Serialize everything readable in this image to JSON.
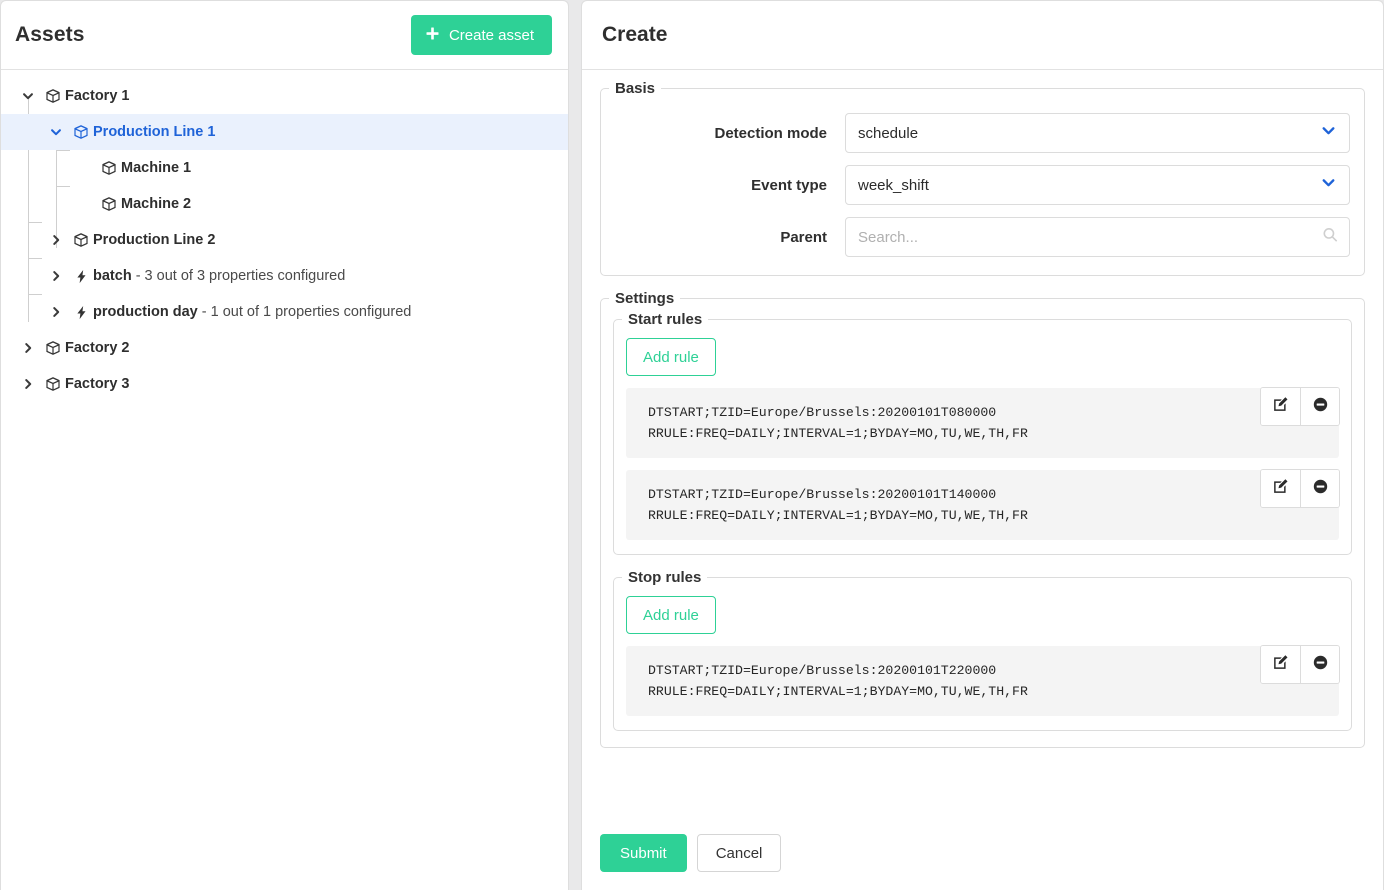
{
  "assets_panel": {
    "title": "Assets",
    "create_button": "Create asset",
    "create_icon": "plus-icon",
    "tree": [
      {
        "label": "Factory 1",
        "icon": "cube-icon",
        "depth": 0,
        "expanded": true,
        "selected": false,
        "has_children": true,
        "suffix": ""
      },
      {
        "label": "Production Line 1",
        "icon": "cube-icon",
        "depth": 1,
        "expanded": true,
        "selected": true,
        "has_children": true,
        "suffix": ""
      },
      {
        "label": "Machine 1",
        "icon": "cube-icon",
        "depth": 2,
        "expanded": false,
        "selected": false,
        "has_children": false,
        "suffix": ""
      },
      {
        "label": "Machine 2",
        "icon": "cube-icon",
        "depth": 2,
        "expanded": false,
        "selected": false,
        "has_children": false,
        "suffix": ""
      },
      {
        "label": "Production Line 2",
        "icon": "cube-icon",
        "depth": 1,
        "expanded": false,
        "selected": false,
        "has_children": true,
        "suffix": ""
      },
      {
        "label": "batch",
        "icon": "bolt-icon",
        "depth": 1,
        "expanded": false,
        "selected": false,
        "has_children": true,
        "suffix": " - 3 out of 3 properties configured"
      },
      {
        "label": "production day",
        "icon": "bolt-icon",
        "depth": 1,
        "expanded": false,
        "selected": false,
        "has_children": true,
        "suffix": " - 1 out of 1 properties configured"
      },
      {
        "label": "Factory 2",
        "icon": "cube-icon",
        "depth": 0,
        "expanded": false,
        "selected": false,
        "has_children": true,
        "suffix": ""
      },
      {
        "label": "Factory 3",
        "icon": "cube-icon",
        "depth": 0,
        "expanded": false,
        "selected": false,
        "has_children": true,
        "suffix": ""
      }
    ]
  },
  "create_panel": {
    "title": "Create",
    "basis": {
      "legend": "Basis",
      "fields": [
        {
          "label": "Detection mode",
          "type": "select",
          "value": "schedule",
          "icon": "chevron-down-icon"
        },
        {
          "label": "Event type",
          "type": "select",
          "value": "week_shift",
          "icon": "chevron-down-icon"
        },
        {
          "label": "Parent",
          "type": "search",
          "value": "",
          "placeholder": "Search...",
          "icon": "search-icon"
        }
      ]
    },
    "settings": {
      "legend": "Settings",
      "start_rules": {
        "legend": "Start rules",
        "add_button": "Add rule",
        "rules": [
          {
            "line1": "DTSTART;TZID=Europe/Brussels:20200101T080000",
            "line2": "RRULE:FREQ=DAILY;INTERVAL=1;BYDAY=MO,TU,WE,TH,FR"
          },
          {
            "line1": "DTSTART;TZID=Europe/Brussels:20200101T140000",
            "line2": "RRULE:FREQ=DAILY;INTERVAL=1;BYDAY=MO,TU,WE,TH,FR"
          }
        ]
      },
      "stop_rules": {
        "legend": "Stop rules",
        "add_button": "Add rule",
        "rules": [
          {
            "line1": "DTSTART;TZID=Europe/Brussels:20200101T220000",
            "line2": "RRULE:FREQ=DAILY;INTERVAL=1;BYDAY=MO,TU,WE,TH,FR"
          }
        ]
      },
      "rule_actions": {
        "edit_icon": "edit-pencil-icon",
        "remove_icon": "minus-circle-icon"
      }
    },
    "footer": {
      "submit": "Submit",
      "cancel": "Cancel"
    }
  },
  "colors": {
    "accent_green": "#2ed196",
    "link_blue": "#1f63d8",
    "selected_row_bg": "#eaf1fd",
    "card_bg": "#f4f4f4"
  }
}
